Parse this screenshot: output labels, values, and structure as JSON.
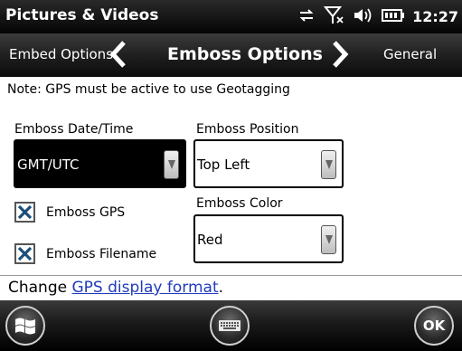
{
  "titlebar": {
    "app_title": "Pictures & Videos",
    "clock": "12:27",
    "icons": [
      "data-arrows-icon",
      "no-signal-icon",
      "volume-icon",
      "battery-icon"
    ]
  },
  "tabs": {
    "prev": "Embed Options",
    "current": "Emboss Options",
    "next": "General"
  },
  "content": {
    "note": "Note: GPS must be active to use Geotagging",
    "emboss_datetime": {
      "label": "Emboss Date/Time",
      "value": "GMT/UTC"
    },
    "emboss_position": {
      "label": "Emboss Position",
      "value": "Top Left"
    },
    "emboss_color": {
      "label": "Emboss Color",
      "value": "Red"
    },
    "emboss_gps": {
      "label": "Emboss GPS",
      "checked": true
    },
    "emboss_filename": {
      "label": "Emboss Filename",
      "checked": true
    }
  },
  "footer": {
    "change_prefix": "Change ",
    "change_link": "GPS display format",
    "change_suffix": "."
  },
  "softkeys": {
    "start_icon": "windows-start-icon",
    "keyboard_icon": "keyboard-icon",
    "ok_label": "OK"
  },
  "colors": {
    "link": "#1f3bbd",
    "selected_field": "#000000"
  }
}
